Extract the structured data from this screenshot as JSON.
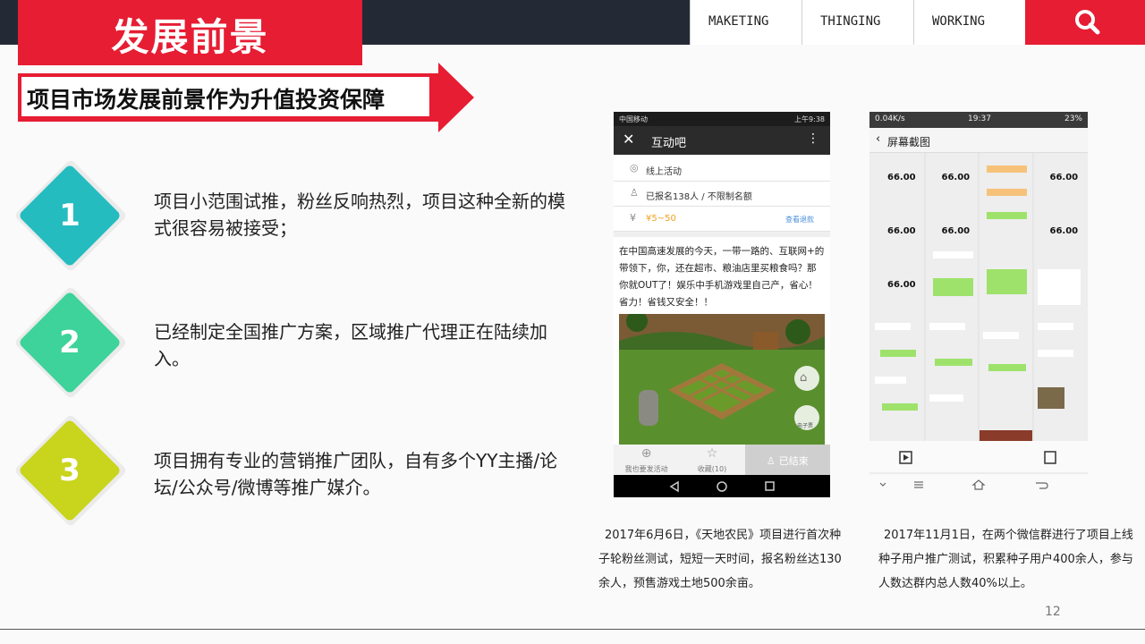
{
  "header": {
    "title": "发展前景",
    "menu": [
      "MAKETING",
      "THINGING",
      "WORKING"
    ]
  },
  "banner": {
    "text": "项目市场发展前景作为升值投资保障"
  },
  "points": [
    {
      "number": "1",
      "text": "项目小范围试推，粉丝反响热烈，项目这种全新的模式很容易被接受；",
      "color": "#25bcc0"
    },
    {
      "number": "2",
      "text": "已经制定全国推广方案，区域推广代理正在陆续加入。",
      "color": "#3dd39a"
    },
    {
      "number": "3",
      "text": "项目拥有专业的营销推广团队，自有多个YY主播/论坛/公众号/微博等推广媒介。",
      "color": "#c9d41d"
    }
  ],
  "phone1": {
    "status_left": "中国移动",
    "status_right": "上午9:38",
    "title": "互动吧",
    "rows": [
      "线上活动",
      "已报名138人 / 不限制名额",
      "¥5~50"
    ],
    "row_link": "查看退款",
    "body_text": "在中国高速发展的今天，一带一路的、互联网+的带领下，你，还在超市、粮油店里买粮食吗？那你就OUT了！娱乐中手机游戏里自己产，省心！省力！省钱又安全！！",
    "tabs": [
      "我也要发活动",
      "收藏(10)",
      "已结束"
    ],
    "side_label": "电子票"
  },
  "phone2": {
    "status_left": "0.04K/s",
    "status_center": "19:37",
    "status_right": "23%",
    "title": "屏幕截图",
    "amounts": [
      "66.00",
      "66.00",
      "66.00",
      "66.00",
      "66.00",
      "66.00",
      "66.00"
    ]
  },
  "captions": [
    "2017年6月6日，《天地农民》项目进行首次种子轮粉丝测试，短短一天时间，报名粉丝达130余人，预售游戏土地500余亩。",
    "2017年11月1日，在两个微信群进行了项目上线种子用户推广测试，积累种子用户400余人，参与人数达群内总人数40%以上。"
  ],
  "page_number": "12",
  "colors": {
    "accent": "#e61d33",
    "dark": "#232a35"
  }
}
